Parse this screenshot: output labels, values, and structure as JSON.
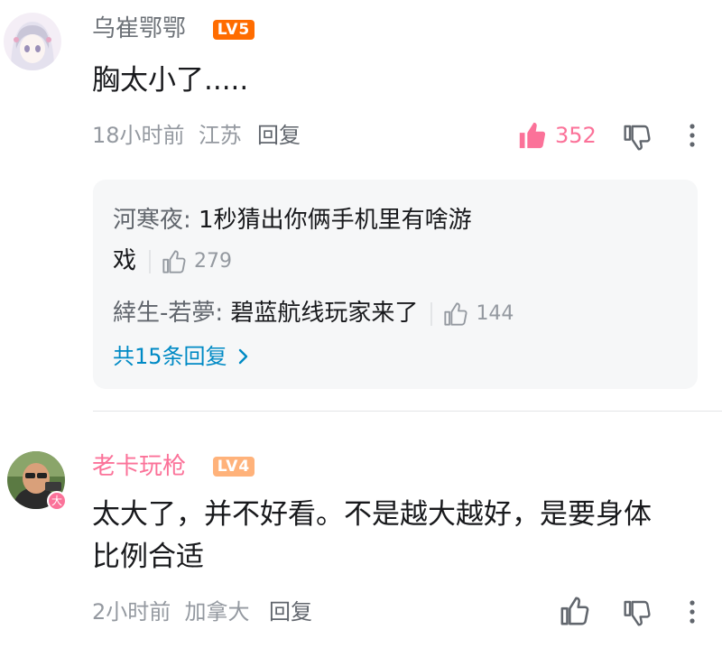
{
  "comments": [
    {
      "username": "乌崔鄂鄂",
      "level": "LV5",
      "content": "胸太小了.....",
      "time": "18小时前",
      "location": "江苏",
      "reply_label": "回复",
      "likes": "352",
      "liked": true,
      "replies": [
        {
          "author": "河寒夜",
          "text": "1秒猜出你俩手机里有啥游",
          "text_cont": "戏",
          "likes": "279"
        },
        {
          "author": "緈生-若夢",
          "text": "碧蓝航线玩家来了",
          "likes": "144"
        }
      ],
      "more_replies": "共15条回复"
    },
    {
      "username": "老卡玩枪",
      "level": "LV4",
      "content_line1": "太大了，并不好看。不是越大越好，是要身体",
      "content_line2": "比例合适",
      "badge": "大",
      "time": "2小时前",
      "location": "加拿大",
      "reply_label": "回复"
    }
  ],
  "colors": {
    "username": "#fb7299",
    "level5": "#ff6c00",
    "level4": "#ffb27a",
    "like_active": "#fb7299",
    "link": "#008ac5"
  }
}
